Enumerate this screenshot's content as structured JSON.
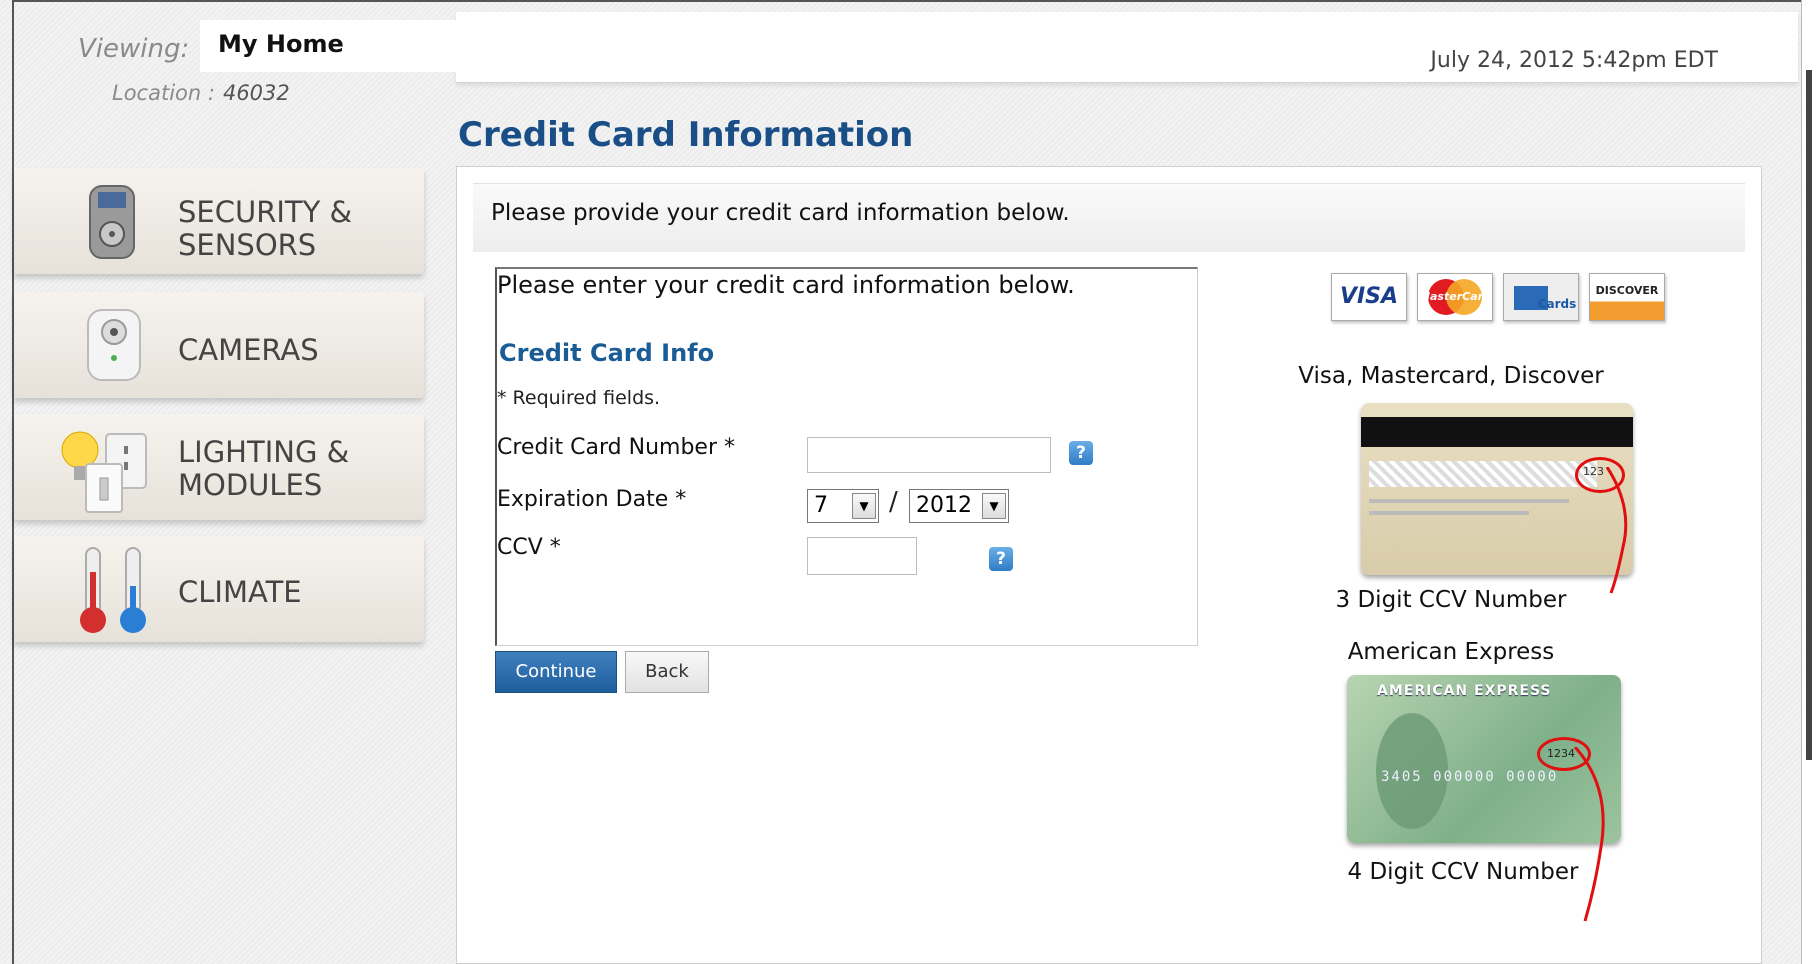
{
  "header": {
    "viewing_label": "Viewing:",
    "home_name": "My Home",
    "location_label": "Location :",
    "location_value": "46032",
    "datetime": "July 24, 2012   5:42pm EDT"
  },
  "sidebar": {
    "items": [
      {
        "label": "SECURITY &\nSENSORS",
        "icon": "keypad-icon"
      },
      {
        "label": "CAMERAS",
        "icon": "camera-icon"
      },
      {
        "label": "LIGHTING &\nMODULES",
        "icon": "lightbulb-outlet-icon"
      },
      {
        "label": "CLIMATE",
        "icon": "thermometer-icon"
      }
    ]
  },
  "page": {
    "title": "Credit Card Information",
    "notice": "Please provide your credit card information below."
  },
  "form": {
    "intro": "Please enter your credit card information below.",
    "section_title": "Credit Card Info",
    "required_note": "* Required fields.",
    "card_number_label": "Credit Card Number *",
    "card_number_value": "",
    "expiration_label": "Expiration Date *",
    "exp_month": "7",
    "exp_separator": "/",
    "exp_year": "2012",
    "ccv_label": "CCV *",
    "ccv_value": "",
    "help_glyph": "?",
    "continue_label": "Continue",
    "back_label": "Back"
  },
  "cards": {
    "logos": [
      "VISA",
      "MasterCard",
      "Cards",
      "DISCOVER"
    ],
    "visa_caption": "Visa, Mastercard, Discover",
    "visa_ccv_caption": "3 Digit CCV Number",
    "visa_ccv_example": "123",
    "amex_caption": "American Express",
    "amex_ccv_caption": "4 Digit CCV Number",
    "amex_ccv_example": "1234",
    "amex_brand": "AMERICAN EXPRESS",
    "amex_number": "3405 000000 00000"
  },
  "colors": {
    "title_blue": "#1a4e86",
    "section_blue": "#1a5c96",
    "button_blue": "#2a6aa9"
  }
}
